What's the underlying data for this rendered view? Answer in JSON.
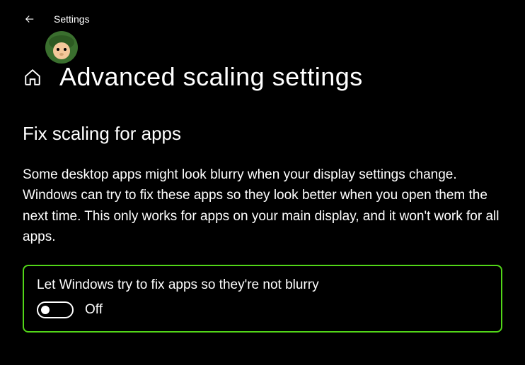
{
  "window": {
    "title": "Settings"
  },
  "page": {
    "title": "Advanced scaling settings"
  },
  "section": {
    "heading": "Fix scaling for apps",
    "description": "Some desktop apps might look blurry when your display settings change. Windows can try to fix these apps so they look better when you open them the next time. This only works for apps on your main display, and it won't work for all apps.",
    "toggle": {
      "label": "Let Windows try to fix apps so they're not blurry",
      "state": "Off",
      "value": false
    }
  },
  "highlight_color": "#52d618"
}
